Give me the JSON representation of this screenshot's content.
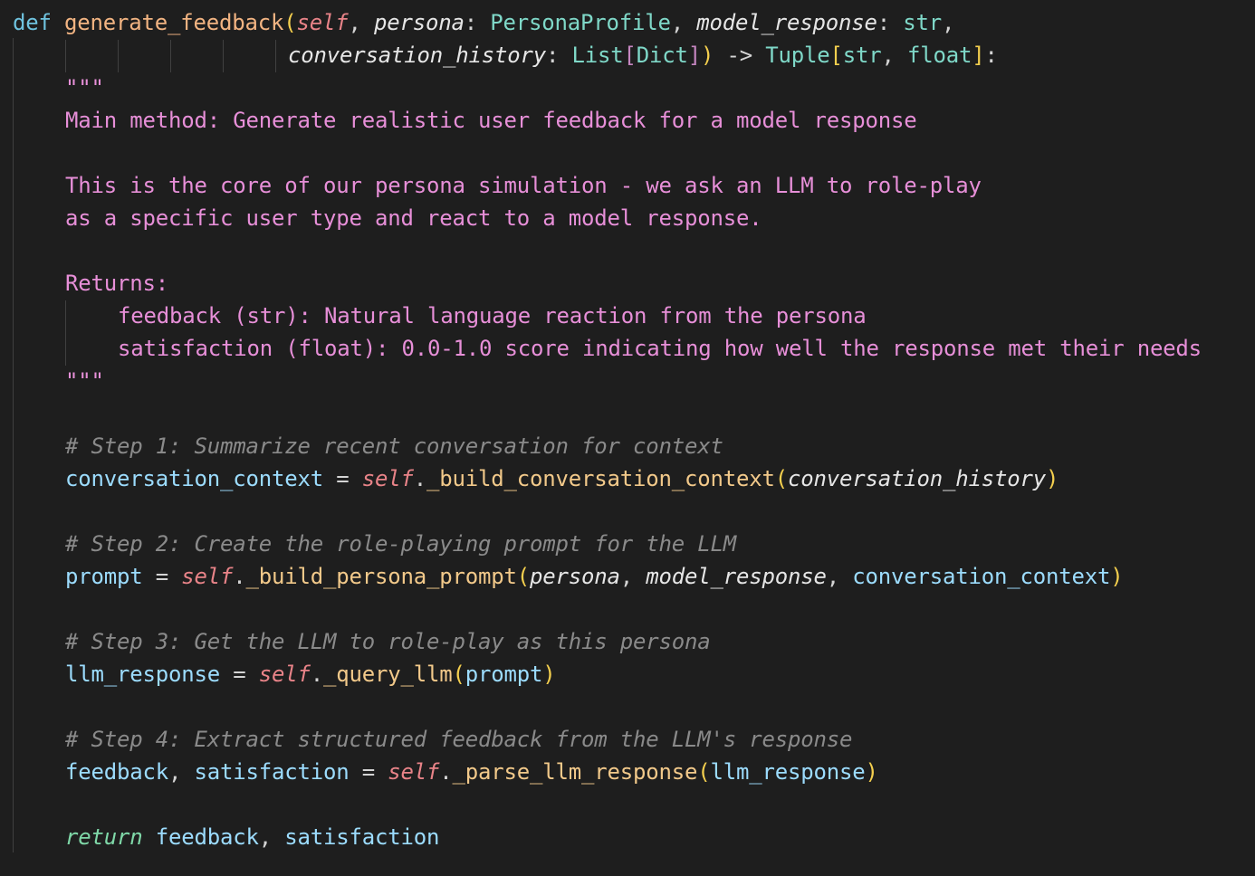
{
  "code": {
    "def_kw": "def",
    "func_name": "generate_feedback",
    "self_param": "self",
    "persona_param": "persona",
    "persona_type": "PersonaProfile",
    "model_response_param": "model_response",
    "str_type": "str",
    "history_param": "conversation_history",
    "list_type": "List",
    "dict_type": "Dict",
    "arrow": "->",
    "tuple_type": "Tuple",
    "float_type": "float",
    "doc_quotes": "\"\"\"",
    "doc_line1": "Main method: Generate realistic user feedback for a model response",
    "doc_line2": "This is the core of our persona simulation - we ask an LLM to role-play",
    "doc_line3": "as a specific user type and react to a model response.",
    "doc_returns": "Returns:",
    "doc_ret1": "feedback (str): Natural language reaction from the persona",
    "doc_ret2": "satisfaction (float): 0.0-1.0 score indicating how well the response met their needs",
    "comment1": "# Step 1: Summarize recent conversation for context",
    "var_context": "conversation_context",
    "method_build_context": "_build_conversation_context",
    "comment2": "# Step 2: Create the role-playing prompt for the LLM",
    "var_prompt": "prompt",
    "method_build_prompt": "_build_persona_prompt",
    "comment3": "# Step 3: Get the LLM to role-play as this persona",
    "var_llm_response": "llm_response",
    "method_query": "_query_llm",
    "comment4": "# Step 4: Extract structured feedback from the LLM's response",
    "var_feedback": "feedback",
    "var_satisfaction": "satisfaction",
    "method_parse": "_parse_llm_response",
    "return_kw": "return"
  },
  "colors": {
    "background": "#1e1e1e",
    "keyword": "#6fc3df",
    "function": "#f2b482",
    "docstring": "#e78fd8",
    "comment": "#8a8a8a",
    "variable": "#9cdcfe"
  }
}
